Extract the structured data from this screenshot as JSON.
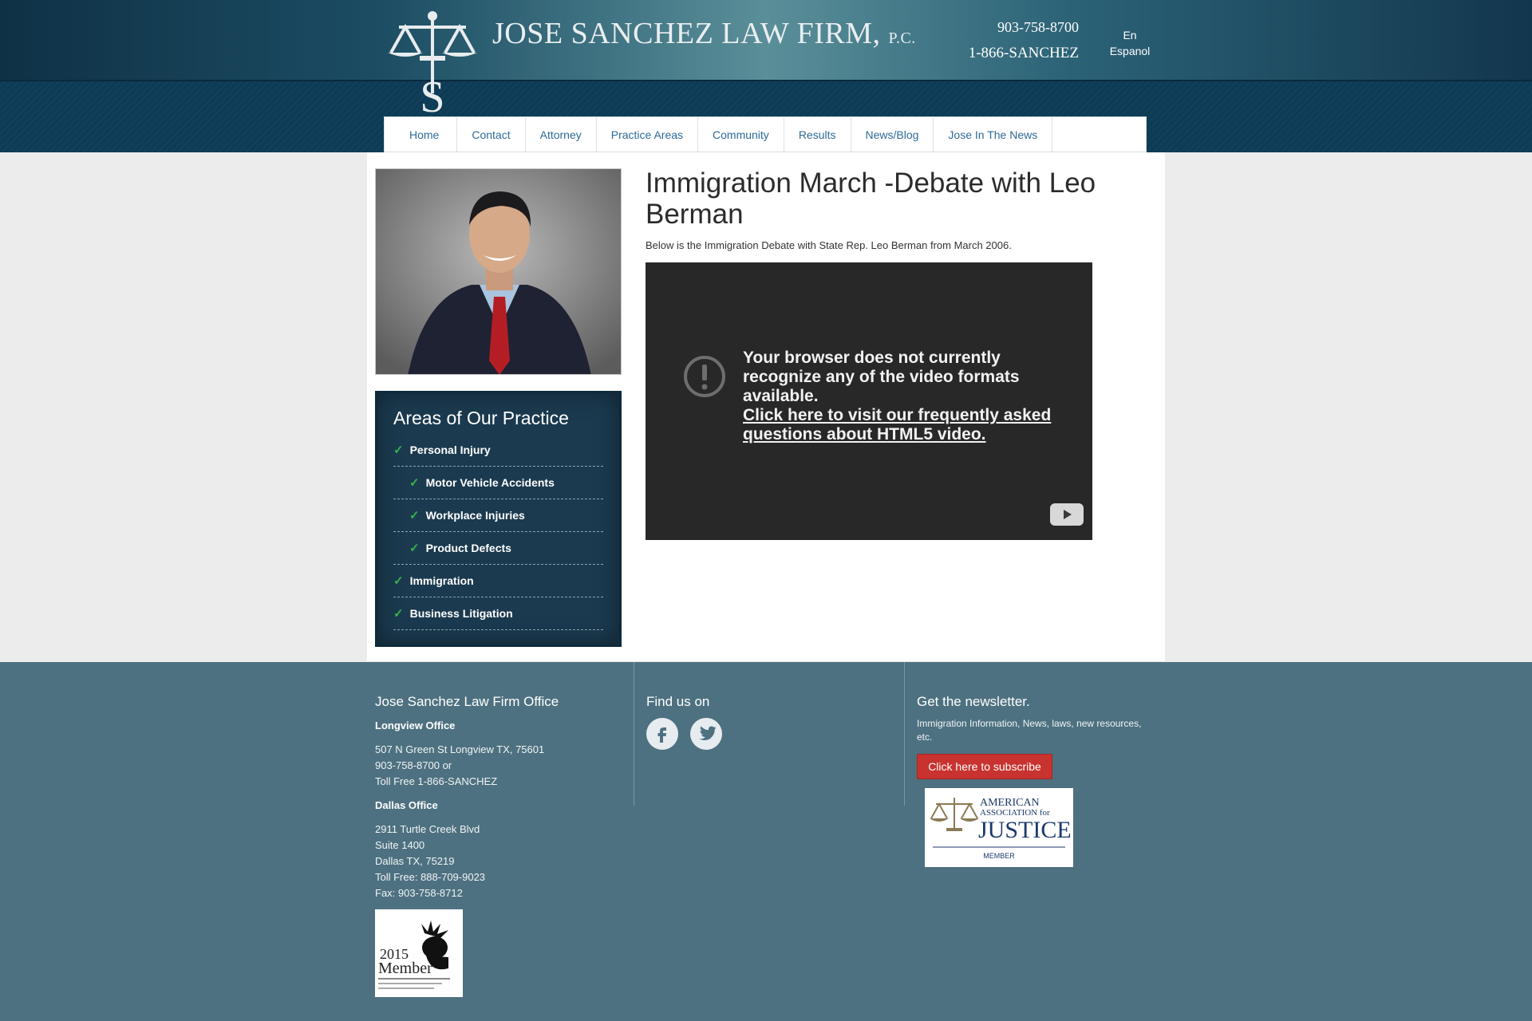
{
  "header": {
    "logo_name": "JOSE SANCHEZ LAW FIRM",
    "logo_suffix": "P.C.",
    "phone_1": "903-758-8700",
    "phone_2": "1-866-SANCHEZ",
    "lang_en": "En",
    "lang_es": "Espanol"
  },
  "nav": {
    "items": [
      "Home",
      "Contact",
      "Attorney",
      "Practice Areas",
      "Community",
      "Results",
      "News/Blog",
      "Jose In The News"
    ]
  },
  "sidebar": {
    "title": "Areas of Our Practice",
    "items": [
      {
        "label": "Personal Injury"
      },
      {
        "label": "Motor Vehicle Accidents"
      },
      {
        "label": "Workplace Injuries"
      },
      {
        "label": "Product Defects"
      },
      {
        "label": "Immigration"
      },
      {
        "label": "Business Litigation"
      }
    ]
  },
  "article": {
    "title": "Immigration March -Debate with Leo Berman",
    "intro": "Below is the Immigration Debate with State Rep. Leo Berman from March 2006.",
    "video_message": "Your browser does not currently recognize any of the video formats available.",
    "video_link": "Click here to visit our frequently asked questions about HTML5 video."
  },
  "footer": {
    "office_heading": "Jose Sanchez Law Firm Office",
    "longview_label": "Longview Office",
    "longview_address": "507 N Green St Longview TX, 75601",
    "longview_phone": "903-758-8700 or",
    "longview_tollfree": "Toll Free 1-866-SANCHEZ",
    "dallas_label": "Dallas Office",
    "dallas_line1": "2911 Turtle Creek Blvd",
    "dallas_line2": "Suite 1400",
    "dallas_line3": "Dallas TX, 75219",
    "dallas_tollfree": "Toll Free: 888-709-9023",
    "dallas_fax": "Fax: 903-758-8712",
    "social_heading": "Find us on",
    "newsletter_heading": "Get the newsletter.",
    "newsletter_text": "Immigration Information, News, laws, new resources, etc.",
    "subscribe_label": "Click here to subscribe",
    "aaj_line1": "AMERICAN",
    "aaj_line2": "ASSOCIATION for",
    "aaj_line3": "JUSTICE",
    "aaj_member": "MEMBER",
    "member_year": "2015",
    "member_word": "Member"
  },
  "colors": {
    "header_dark": "#0f3146",
    "nav_link": "#2d6a98",
    "sidebar_bg": "#1b3a4f",
    "check": "#36b34a",
    "footer_bg": "#4e7181",
    "subscribe_bg": "#c8332f"
  }
}
